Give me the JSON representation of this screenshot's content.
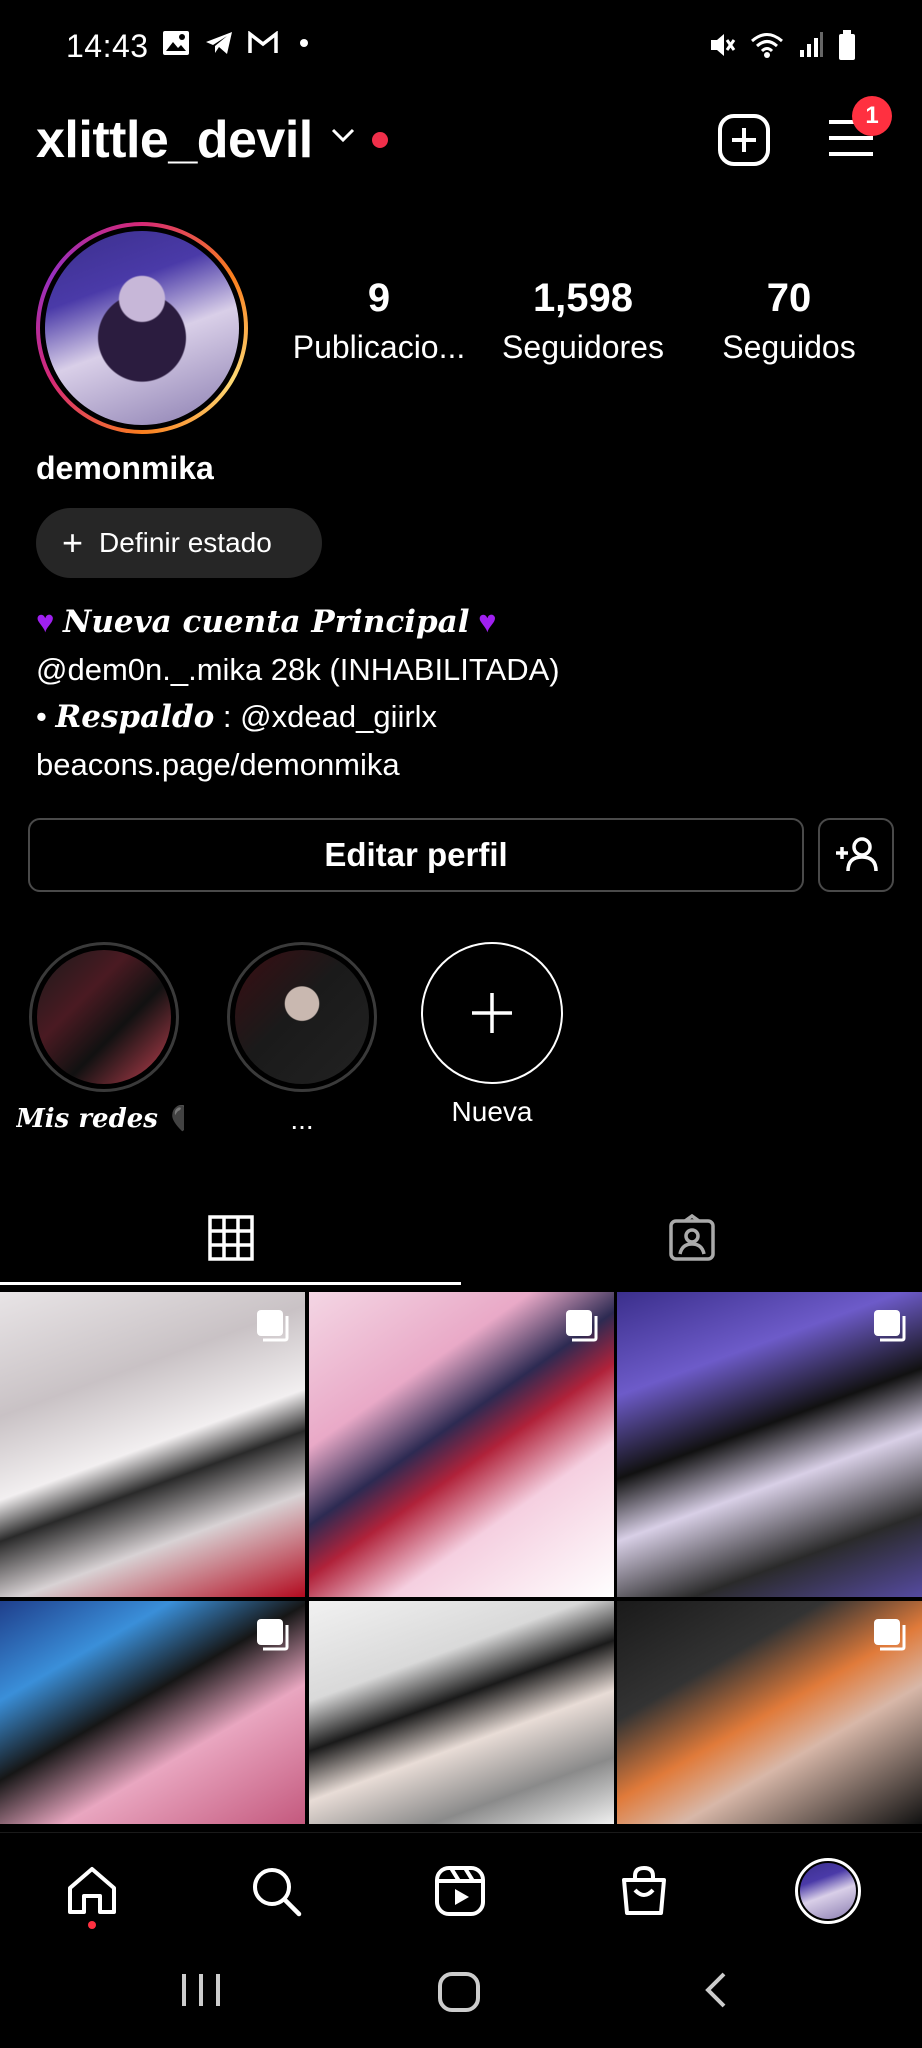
{
  "status_bar": {
    "time": "14:43"
  },
  "header": {
    "username": "xlittle_devil",
    "notifications": "1"
  },
  "profile": {
    "stats": [
      {
        "value": "9",
        "label": "Publicacio..."
      },
      {
        "value": "1,598",
        "label": "Seguidores"
      },
      {
        "value": "70",
        "label": "Seguidos"
      }
    ],
    "name": "demonmika",
    "status_button": "Definir estado",
    "bio_line1": "Nueva cuenta Principal",
    "bio_line2": "@dem0n._.mika 28k (INHABILITADA)",
    "bio_line3_prefix": "• ",
    "bio_line3_gothic": "Respaldo",
    "bio_line3_suffix": " : @xdead_giirlx",
    "bio_link": "beacons.page/demonmika",
    "edit_button": "Editar perfil"
  },
  "highlights": [
    {
      "label": "Mis redes 🖤"
    },
    {
      "label": "..."
    },
    {
      "label": "Nueva"
    }
  ],
  "colors": {
    "accent_red": "#ff3040",
    "heart_purple": "#a020f0",
    "pill_bg": "#262626"
  }
}
